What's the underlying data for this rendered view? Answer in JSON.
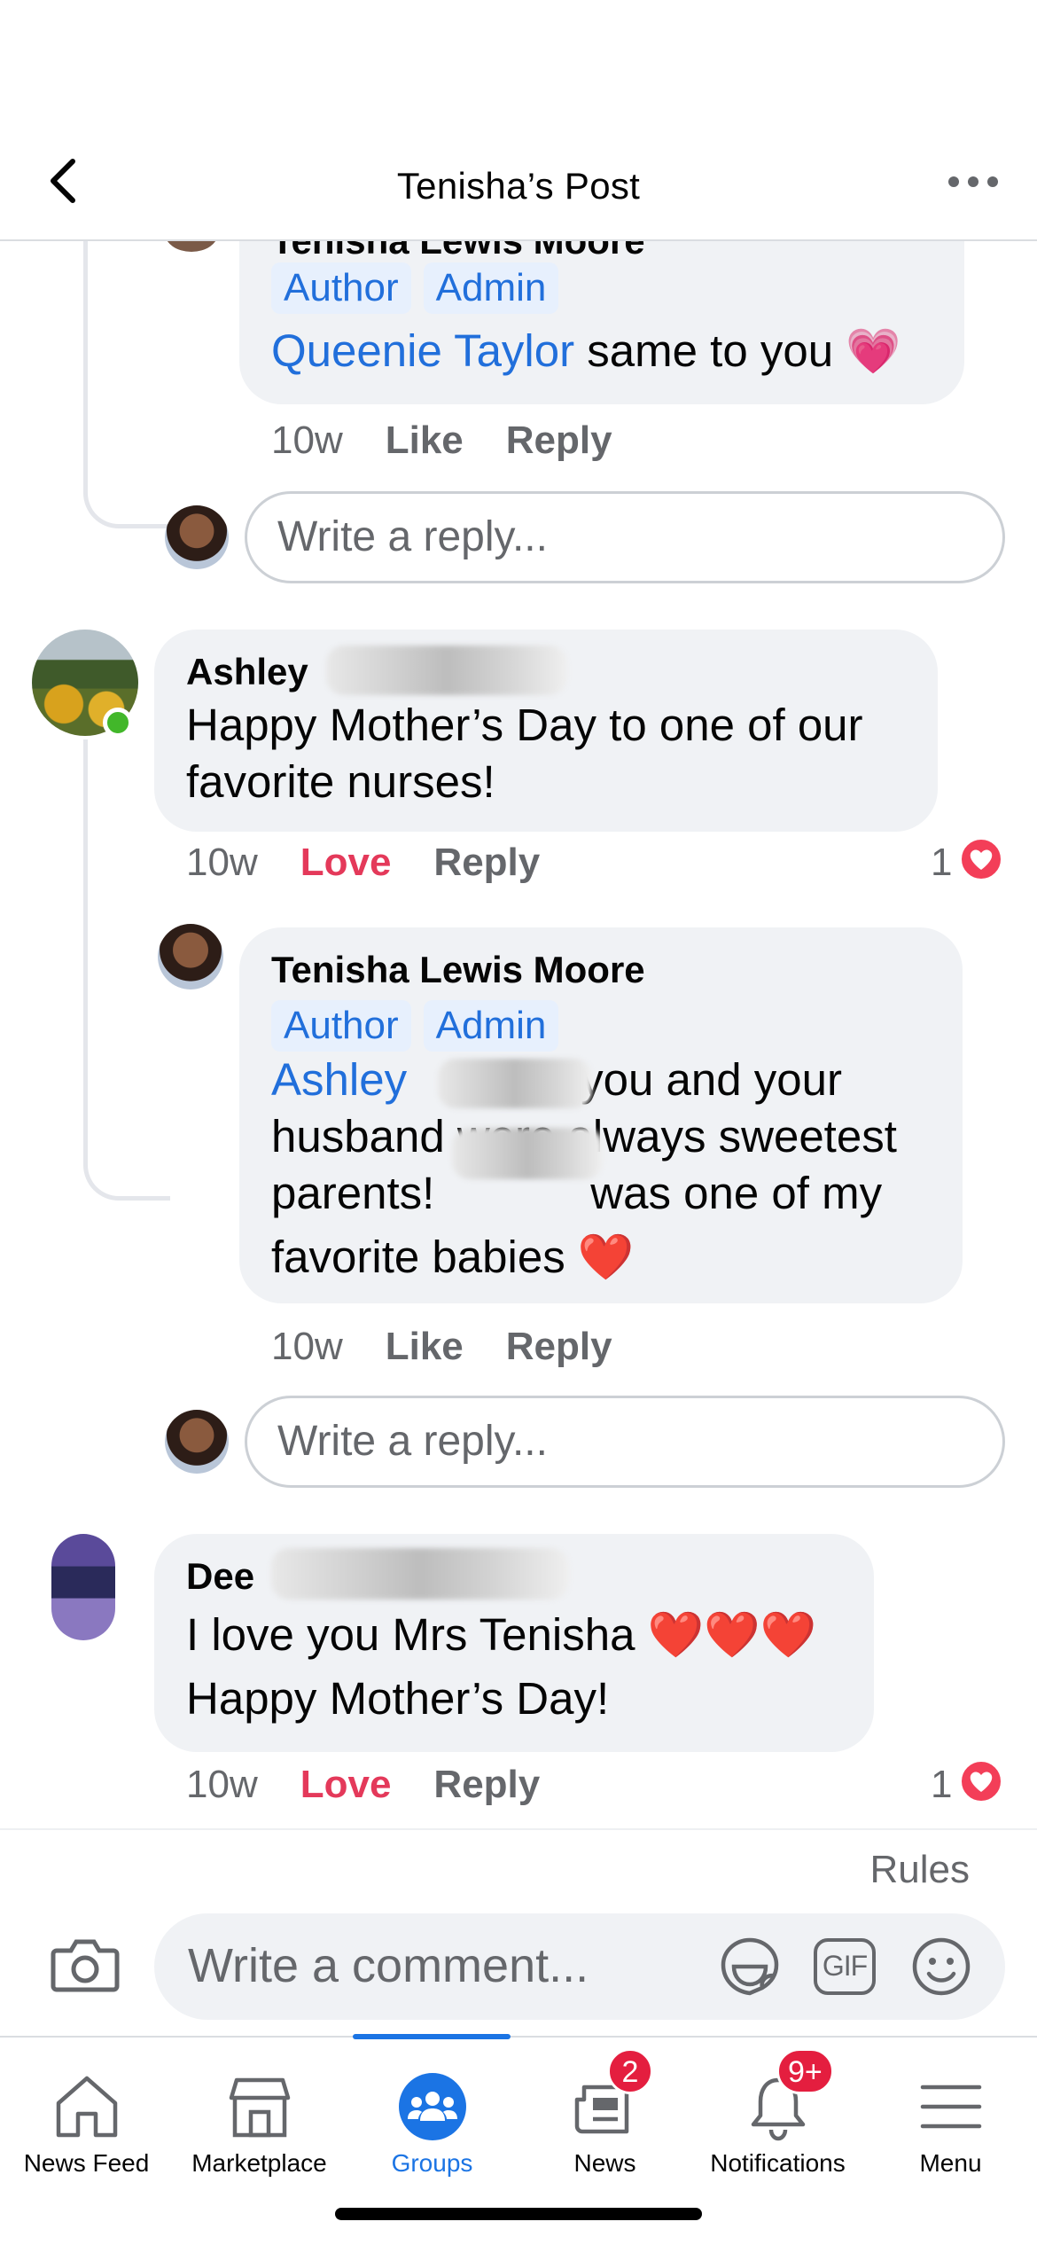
{
  "header": {
    "title": "Tenisha’s Post"
  },
  "partial_comment": {
    "author": "Tenisha Lewis Moore",
    "badges": [
      "Author",
      "Admin"
    ],
    "mention": "Queenie Taylor",
    "text": "same to you",
    "emoji": "💗",
    "time": "10w",
    "like": "Like",
    "reply": "Reply"
  },
  "reply_placeholder": "Write a reply...",
  "comments": [
    {
      "author": "Ashley",
      "text": "Happy Mother’s Day to one of our favorite nurses!",
      "time": "10w",
      "reaction_label": "Love",
      "reply": "Reply",
      "reaction_count": "1",
      "reply_item": {
        "author": "Tenisha Lewis Moore",
        "badges": [
          "Author",
          "Admin"
        ],
        "mention": "Ashley",
        "line1": "you and your",
        "line2": "husband were always sweetest",
        "line3a": "parents!",
        "line3b": "was one of my",
        "line4": "favorite babies",
        "emoji": "❤️",
        "time": "10w",
        "like": "Like",
        "reply": "Reply"
      }
    },
    {
      "author": "Dee",
      "line1": "I love you Mrs Tenisha ❤️❤️❤️",
      "line2": "Happy Mother’s Day!",
      "time": "10w",
      "reaction_label": "Love",
      "reply": "Reply",
      "reaction_count": "1"
    }
  ],
  "composer": {
    "rules": "Rules",
    "placeholder": "Write a comment...",
    "gif": "GIF"
  },
  "tabs": [
    {
      "label": "News Feed",
      "icon": "home-icon"
    },
    {
      "label": "Marketplace",
      "icon": "store-icon"
    },
    {
      "label": "Groups",
      "icon": "groups-icon",
      "active": true
    },
    {
      "label": "News",
      "icon": "news-icon",
      "badge": "2"
    },
    {
      "label": "Notifications",
      "icon": "bell-icon",
      "badge": "9+"
    },
    {
      "label": "Menu",
      "icon": "menu-icon"
    }
  ],
  "colors": {
    "accent": "#1b74e4",
    "mention": "#216fdb",
    "love": "#e4395a",
    "badge": "#e41e3f"
  }
}
